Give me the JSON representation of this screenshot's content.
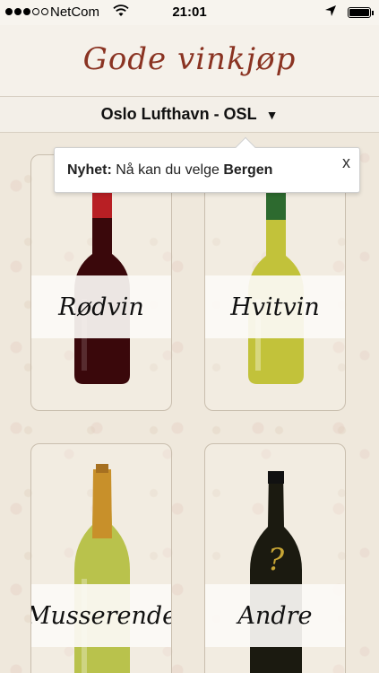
{
  "status_bar": {
    "carrier": "NetCom",
    "time": "21:01",
    "signal_bars_filled": 3,
    "signal_bars_total": 5
  },
  "header": {
    "title": "Gode vinkjøp"
  },
  "location": {
    "label": "Oslo Lufthavn - OSL",
    "caret": "▼"
  },
  "popup": {
    "prefix": "Nyhet:",
    "message": " Nå kan du velge ",
    "highlight": "Bergen",
    "close": "x"
  },
  "categories": [
    {
      "label": "Rødvin",
      "bottle": "red-wine-bottle-icon",
      "color": "#5a0f12"
    },
    {
      "label": "Hvitvin",
      "bottle": "white-wine-bottle-icon",
      "color": "#c9c640"
    },
    {
      "label": "Musserende",
      "bottle": "sparkling-wine-bottle-icon",
      "color": "#c8ca5a"
    },
    {
      "label": "Andre",
      "bottle": "other-wine-bottle-icon",
      "color": "#1b1a10",
      "mark": "?"
    }
  ],
  "colors": {
    "title": "#8a3322",
    "badge": "#f0c53a"
  }
}
